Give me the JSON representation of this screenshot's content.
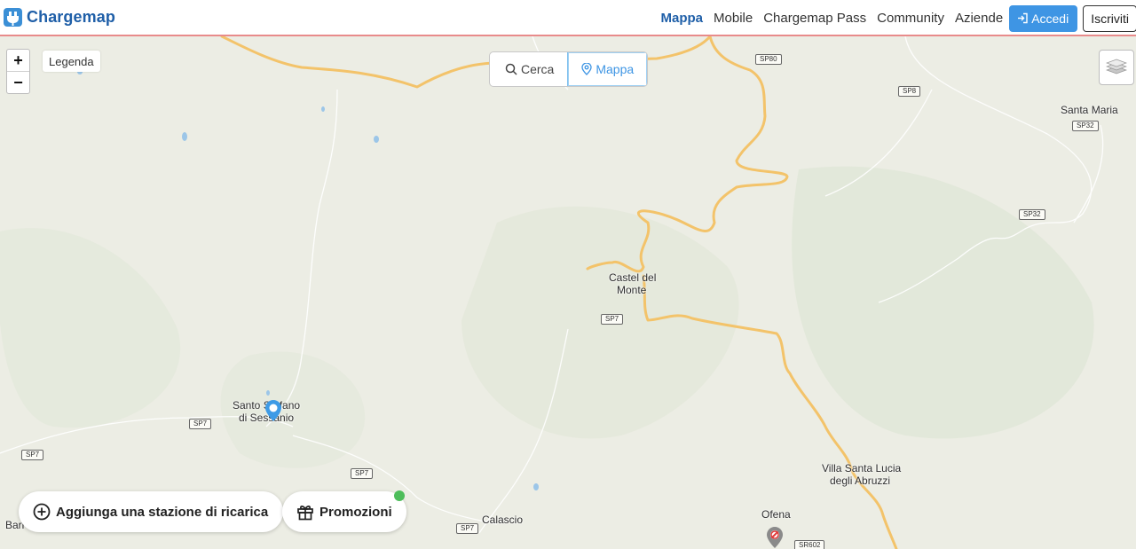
{
  "header": {
    "logo_text": "Chargemap",
    "nav": [
      "Mappa",
      "Mobile",
      "Chargemap Pass",
      "Community",
      "Aziende"
    ],
    "login_label": "Accedi",
    "signup_label": "Iscriviti",
    "brand_color": "#1f5fa8",
    "accent_color": "#3e95e4"
  },
  "map": {
    "zoom_in": "+",
    "zoom_out": "−",
    "legend_label": "Legenda",
    "view_toggle": {
      "search_label": "Cerca",
      "map_label": "Mappa",
      "selected": "Mappa"
    },
    "places": {
      "santa_maria": "Santa Maria",
      "castel_del_monte_1": "Castel del",
      "castel_del_monte_2": "Monte",
      "santo_stefano_1": "Santo Stefano",
      "santo_stefano_2": "di Sessanio",
      "villa_santa_lucia_1": "Villa Santa Lucia",
      "villa_santa_lucia_2": "degli Abruzzi",
      "calascio": "Calascio",
      "ofena": "Ofena",
      "barisciano_partial": "Bari"
    },
    "road_shields": {
      "sp80": "SP80",
      "sp8": "SP8",
      "sp32_a": "SP32",
      "sp32_b": "SP32",
      "sp7_a": "SP7",
      "sp7_b": "SP7",
      "sp7_c": "SP7",
      "sp7_d": "SP7",
      "sp7_e": "SP7",
      "sr602": "SR602"
    },
    "add_station_label": "Aggiunga una stazione di ricarica",
    "promotions_label": "Promozioni"
  }
}
